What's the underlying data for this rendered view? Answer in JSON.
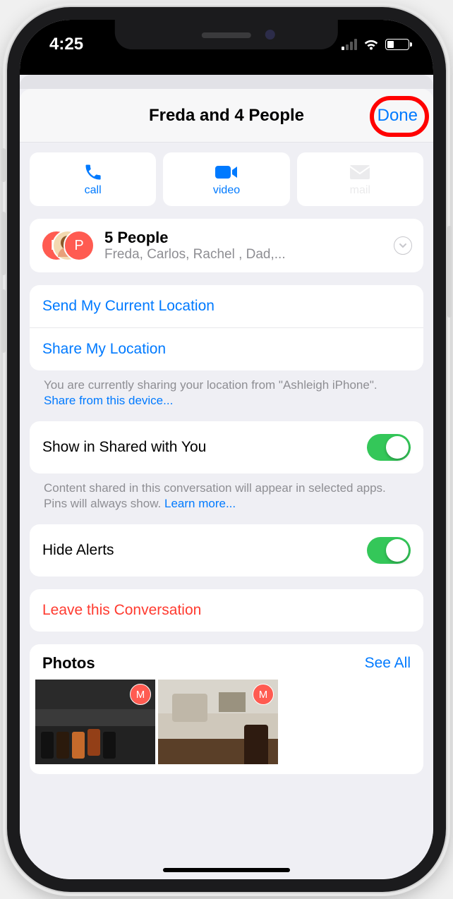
{
  "status": {
    "time": "4:25"
  },
  "header": {
    "title": "Freda and 4 People",
    "done": "Done"
  },
  "actions": {
    "call": {
      "label": "call",
      "icon": "phone-icon",
      "enabled": true
    },
    "video": {
      "label": "video",
      "icon": "video-icon",
      "enabled": true
    },
    "mail": {
      "label": "mail",
      "icon": "envelope-icon",
      "enabled": false
    }
  },
  "people": {
    "title": "5 People",
    "subtitle": "Freda, Carlos, Rachel , Dad,...",
    "avatars": [
      {
        "initial": "M",
        "color": "#ff5b51"
      },
      {
        "initial": "",
        "color": "#f3d9b1"
      },
      {
        "initial": "P",
        "color": "#ff5b51"
      }
    ]
  },
  "location": {
    "send_current": "Send My Current Location",
    "share": "Share My Location",
    "note_prefix": "You are currently sharing your location from \"Ashleigh iPhone\". ",
    "note_link": "Share from this device..."
  },
  "shared_with_you": {
    "label": "Show in Shared with You",
    "on": true,
    "note_prefix": "Content shared in this conversation will appear in selected apps. Pins will always show. ",
    "note_link": "Learn more..."
  },
  "hide_alerts": {
    "label": "Hide Alerts",
    "on": true
  },
  "leave": {
    "label": "Leave this Conversation"
  },
  "photos": {
    "title": "Photos",
    "see_all": "See All",
    "items": [
      {
        "badge": "M"
      },
      {
        "badge": "M"
      }
    ]
  }
}
